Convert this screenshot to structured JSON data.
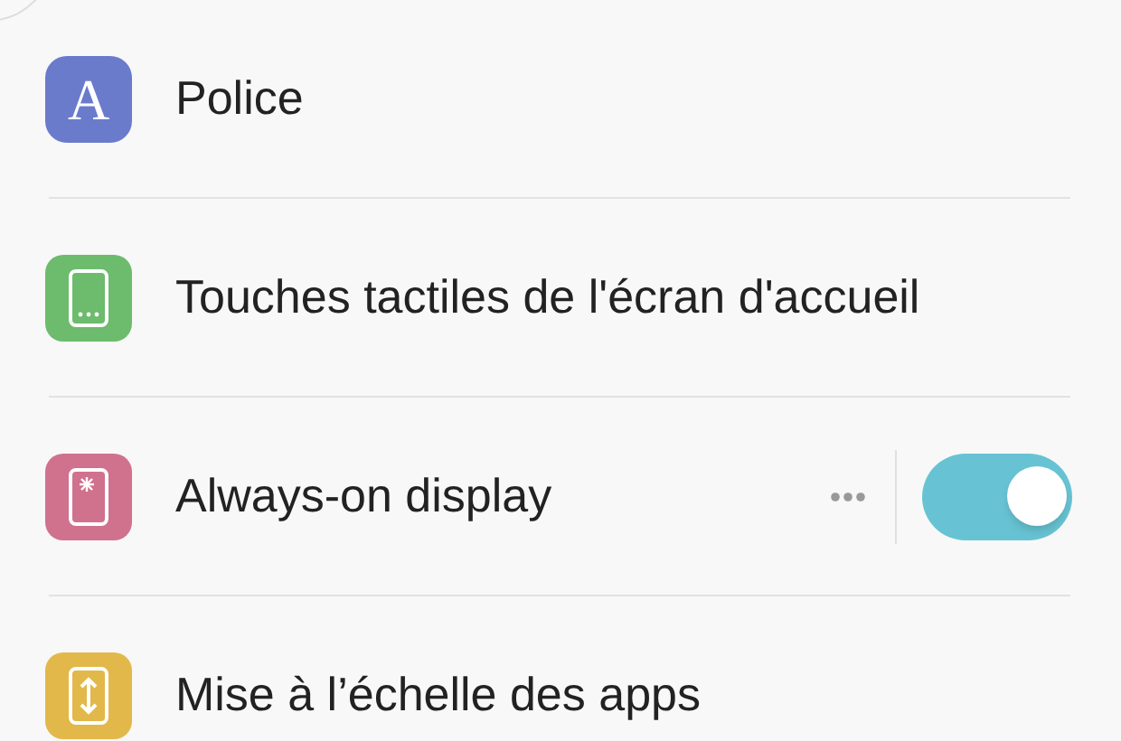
{
  "items": [
    {
      "label": "Police",
      "kind": "letter",
      "icon_text": "A",
      "color": "#6a7bcc"
    },
    {
      "label": "Touches tactiles de l'écran d'accueil",
      "kind": "dots",
      "color": "#6dbb6d"
    },
    {
      "label": "Always-on display",
      "kind": "spark",
      "color": "#d0718e",
      "more": true,
      "toggle": {
        "on": true
      }
    },
    {
      "label": "Mise à l’échelle des apps",
      "kind": "resize",
      "color": "#e2b84a"
    }
  ]
}
